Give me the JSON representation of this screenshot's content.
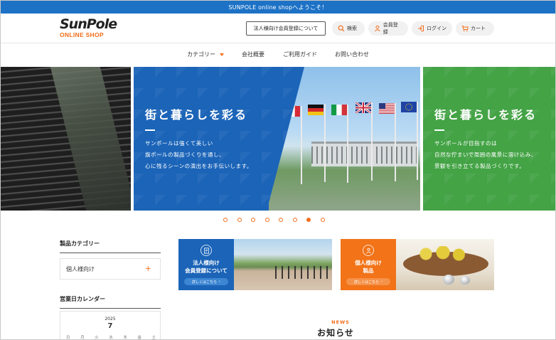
{
  "topbar": {
    "text": "SUNPOLE online shopへようこそ！"
  },
  "logo": {
    "brand": "SunPole",
    "sub": "ONLINE SHOP"
  },
  "header": {
    "corporate_btn": "法人様向け会員登録について",
    "search": "検索",
    "register": "会員登録",
    "login": "ログイン",
    "cart": "カート"
  },
  "nav": {
    "category": "カテゴリー",
    "company": "会社概要",
    "guide": "ご利用ガイド",
    "contact": "お問い合わせ"
  },
  "slider": {
    "main_title": "街と暮らしを彩る",
    "main_lines": [
      "サンポールは強くて美しい",
      "旗ポールの製品づくりを通し、",
      "心に残るシーンの演出をお手伝いします。"
    ],
    "right_title": "街と暮らしを彩る",
    "right_lines": [
      "サンポールが目指すのは",
      "自然な佇まいで周囲の風景に溶け込み、",
      "景観を引き立てる製品づくりです。"
    ],
    "dot_count": 8,
    "active_dot": 7
  },
  "sidebar": {
    "category_heading": "製品カテゴリー",
    "category_item": "個人様向け",
    "calendar_heading": "営業日カレンダー",
    "calendar_year": "2025",
    "calendar_month": "7",
    "weekdays": [
      "日",
      "月",
      "火",
      "水",
      "木",
      "金",
      "土"
    ]
  },
  "banners": {
    "corporate": {
      "text": "法人様向け\n会員登録について",
      "button": "詳しくはこちら",
      "color": "#1b64b8"
    },
    "personal": {
      "text": "個人様向け\n製品",
      "button": "詳しくはこちら",
      "color": "#f27318"
    }
  },
  "news": {
    "label": "NEWS",
    "title": "お知らせ"
  },
  "colors": {
    "brand_blue": "#1d72c6",
    "accent_orange": "#f26d1a",
    "green": "#43a345"
  }
}
